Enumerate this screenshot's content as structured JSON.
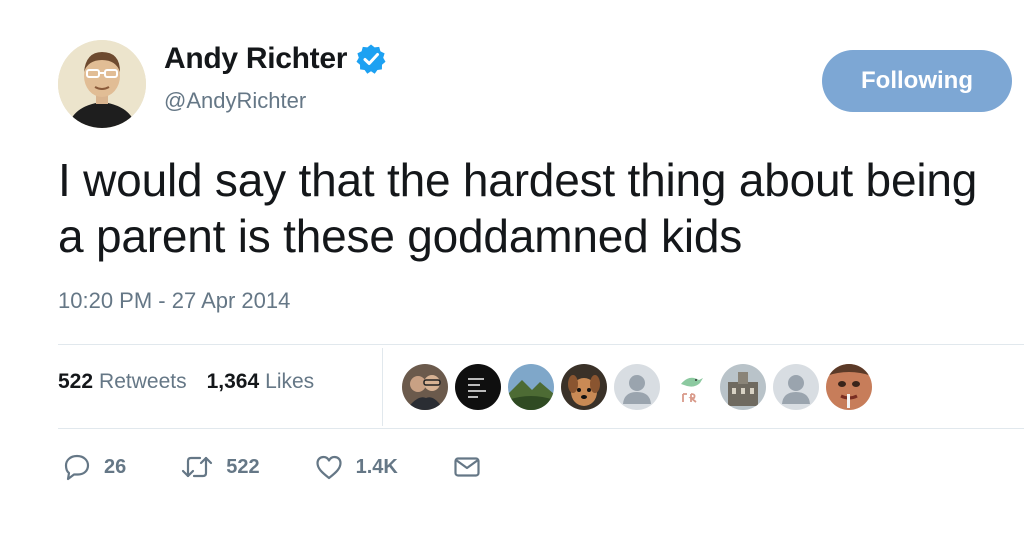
{
  "user": {
    "name": "Andy Richter",
    "handle": "@AndyRichter",
    "verified": true,
    "follow_label": "Following"
  },
  "tweet": {
    "text": "I would say that the hardest thing about being a parent is these goddamned kids",
    "timestamp": "10:20 PM - 27 Apr 2014"
  },
  "stats": {
    "retweets_count": "522",
    "retweets_label": "Retweets",
    "likes_count": "1,364",
    "likes_label": "Likes"
  },
  "likers": [
    {
      "icon": "couple-photo-avatar"
    },
    {
      "icon": "black-logo-avatar"
    },
    {
      "icon": "landscape-avatar"
    },
    {
      "icon": "dog-avatar"
    },
    {
      "icon": "default-person-avatar"
    },
    {
      "icon": "bird-jr-logo-avatar"
    },
    {
      "icon": "building-avatar"
    },
    {
      "icon": "default-person-avatar"
    },
    {
      "icon": "face-closeup-avatar"
    }
  ],
  "actions": {
    "replies": "26",
    "retweets": "522",
    "likes": "1.4K"
  },
  "colors": {
    "follow_button": "#7da7d4",
    "verified_badge": "#1da1f2",
    "secondary_text": "#657786"
  }
}
